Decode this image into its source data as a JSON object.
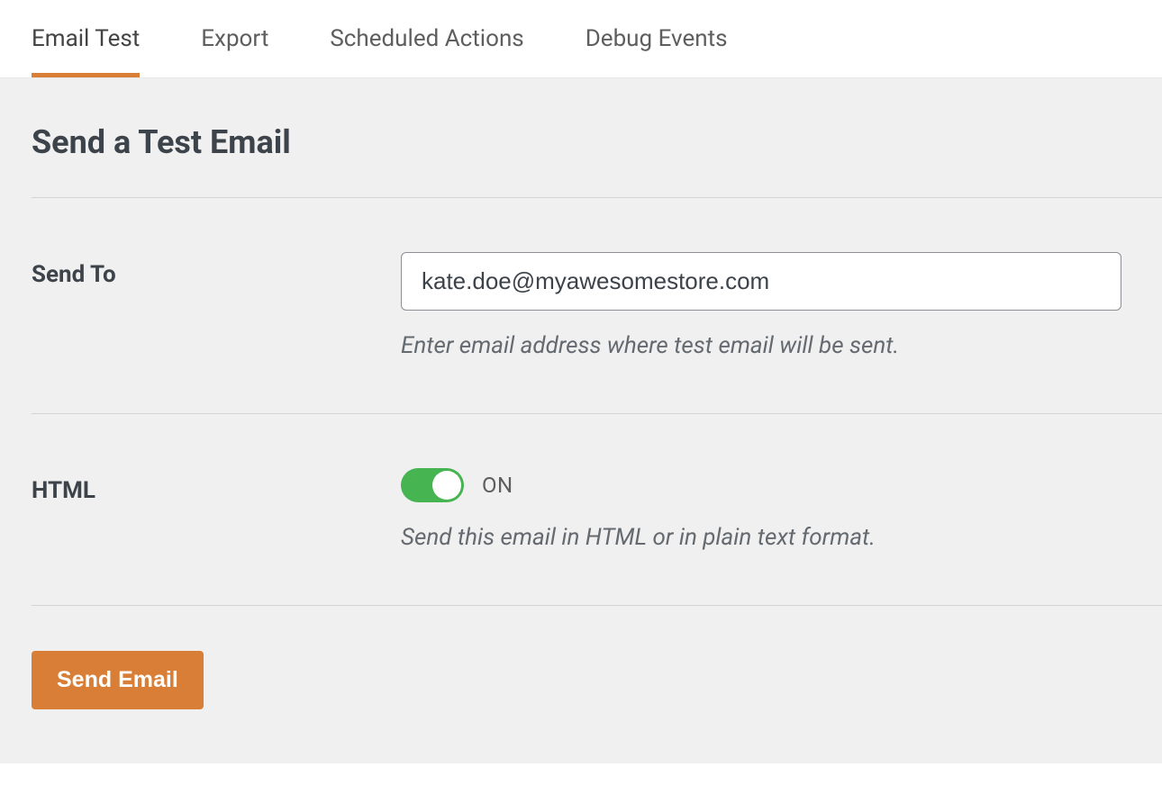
{
  "tabs": [
    {
      "label": "Email Test",
      "active": true
    },
    {
      "label": "Export",
      "active": false
    },
    {
      "label": "Scheduled Actions",
      "active": false
    },
    {
      "label": "Debug Events",
      "active": false
    }
  ],
  "page": {
    "title": "Send a Test Email"
  },
  "form": {
    "send_to": {
      "label": "Send To",
      "value": "kate.doe@myawesomestore.com",
      "help": "Enter email address where test email will be sent."
    },
    "html": {
      "label": "HTML",
      "state": "ON",
      "help": "Send this email in HTML or in plain text format."
    }
  },
  "actions": {
    "send_email": "Send Email"
  },
  "colors": {
    "accent": "#d87e36",
    "toggle_on": "#46b450"
  }
}
